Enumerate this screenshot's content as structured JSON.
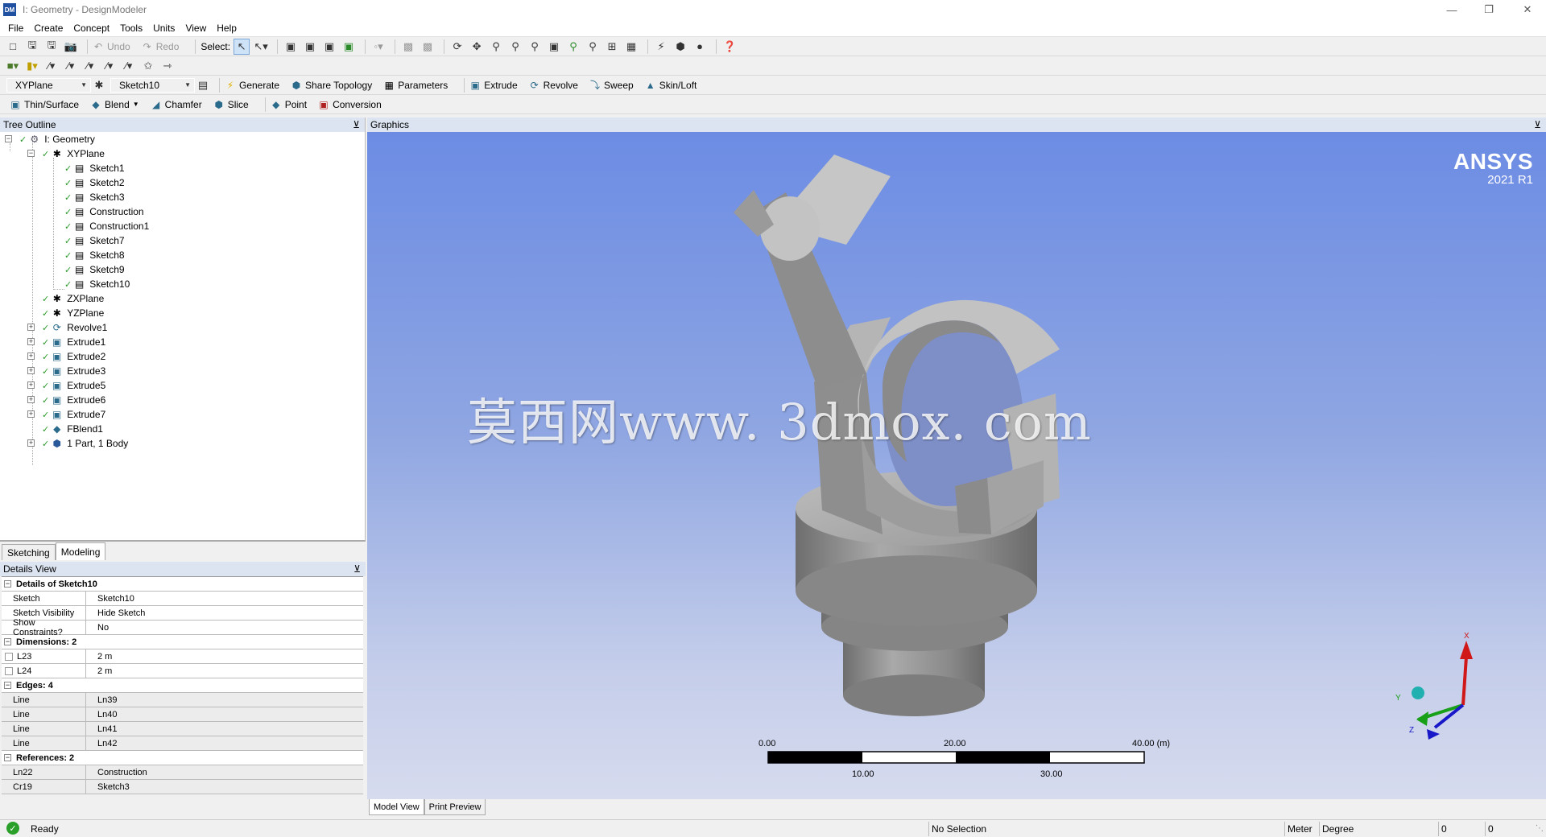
{
  "window": {
    "title": "I: Geometry - DesignModeler",
    "app_icon": "DM",
    "controls": [
      "minimize",
      "restore",
      "close"
    ]
  },
  "menu": [
    "File",
    "Create",
    "Concept",
    "Tools",
    "Units",
    "View",
    "Help"
  ],
  "toolbar1": {
    "undo": "Undo",
    "redo": "Redo",
    "select": "Select:"
  },
  "toolbar3": {
    "plane": "XYPlane",
    "sketch": "Sketch10",
    "generate": "Generate",
    "share_topology": "Share Topology",
    "parameters": "Parameters",
    "extrude": "Extrude",
    "revolve": "Revolve",
    "sweep": "Sweep",
    "skin_loft": "Skin/Loft"
  },
  "toolbar4": {
    "thin_surface": "Thin/Surface",
    "blend": "Blend",
    "chamfer": "Chamfer",
    "slice": "Slice",
    "point": "Point",
    "conversion": "Conversion"
  },
  "tree": {
    "title": "Tree Outline",
    "root": "I: Geometry",
    "xyplane": "XYPlane",
    "sketches": [
      "Sketch1",
      "Sketch2",
      "Sketch3",
      "Construction",
      "Construction1",
      "Sketch7",
      "Sketch8",
      "Sketch9",
      "Sketch10"
    ],
    "zxplane": "ZXPlane",
    "yzplane": "YZPlane",
    "features": [
      "Revolve1",
      "Extrude1",
      "Extrude2",
      "Extrude3",
      "Extrude5",
      "Extrude6",
      "Extrude7"
    ],
    "fblend": "FBlend1",
    "bodies": "1 Part, 1 Body"
  },
  "mode_tabs": [
    "Sketching",
    "Modeling"
  ],
  "details": {
    "title": "Details View",
    "sections": [
      {
        "label": "Details of Sketch10",
        "rows": [
          {
            "k": "Sketch",
            "v": "Sketch10"
          },
          {
            "k": "Sketch Visibility",
            "v": "Hide Sketch"
          },
          {
            "k": "Show Constraints?",
            "v": "No"
          }
        ]
      },
      {
        "label": "Dimensions: 2",
        "rows": [
          {
            "k": "L23",
            "v": "2 m"
          },
          {
            "k": "L24",
            "v": "2 m"
          }
        ]
      },
      {
        "label": "Edges: 4",
        "rows": [
          {
            "k": "Line",
            "v": "Ln39"
          },
          {
            "k": "Line",
            "v": "Ln40"
          },
          {
            "k": "Line",
            "v": "Ln41"
          },
          {
            "k": "Line",
            "v": "Ln42"
          }
        ]
      },
      {
        "label": "References: 2",
        "rows": [
          {
            "k": "Ln22",
            "v": "Construction"
          },
          {
            "k": "Cr19",
            "v": "Sketch3"
          }
        ]
      }
    ]
  },
  "graphics": {
    "title": "Graphics",
    "brand": "ANSYS",
    "version": "2021 R1",
    "watermark": "莫西网www. 3dmox. com",
    "scale_top": [
      "0.00",
      "20.00",
      "40.00 (m)"
    ],
    "scale_bottom": [
      "10.00",
      "30.00"
    ],
    "triad": {
      "x": "X",
      "y": "Y",
      "z": "Z"
    }
  },
  "bottom_tabs": [
    "Model View",
    "Print Preview"
  ],
  "status": {
    "ready": "Ready",
    "selection": "No Selection",
    "length_unit": "Meter",
    "angle_unit": "Degree",
    "field1": "0",
    "field2": "0"
  },
  "colors": {
    "panel_header": "#dbe4f0",
    "viewport_top": "#6c8ce4",
    "viewport_bottom": "#d6dbee",
    "axis_x": "#d01818",
    "axis_y": "#18a018",
    "axis_z": "#1818c8"
  }
}
